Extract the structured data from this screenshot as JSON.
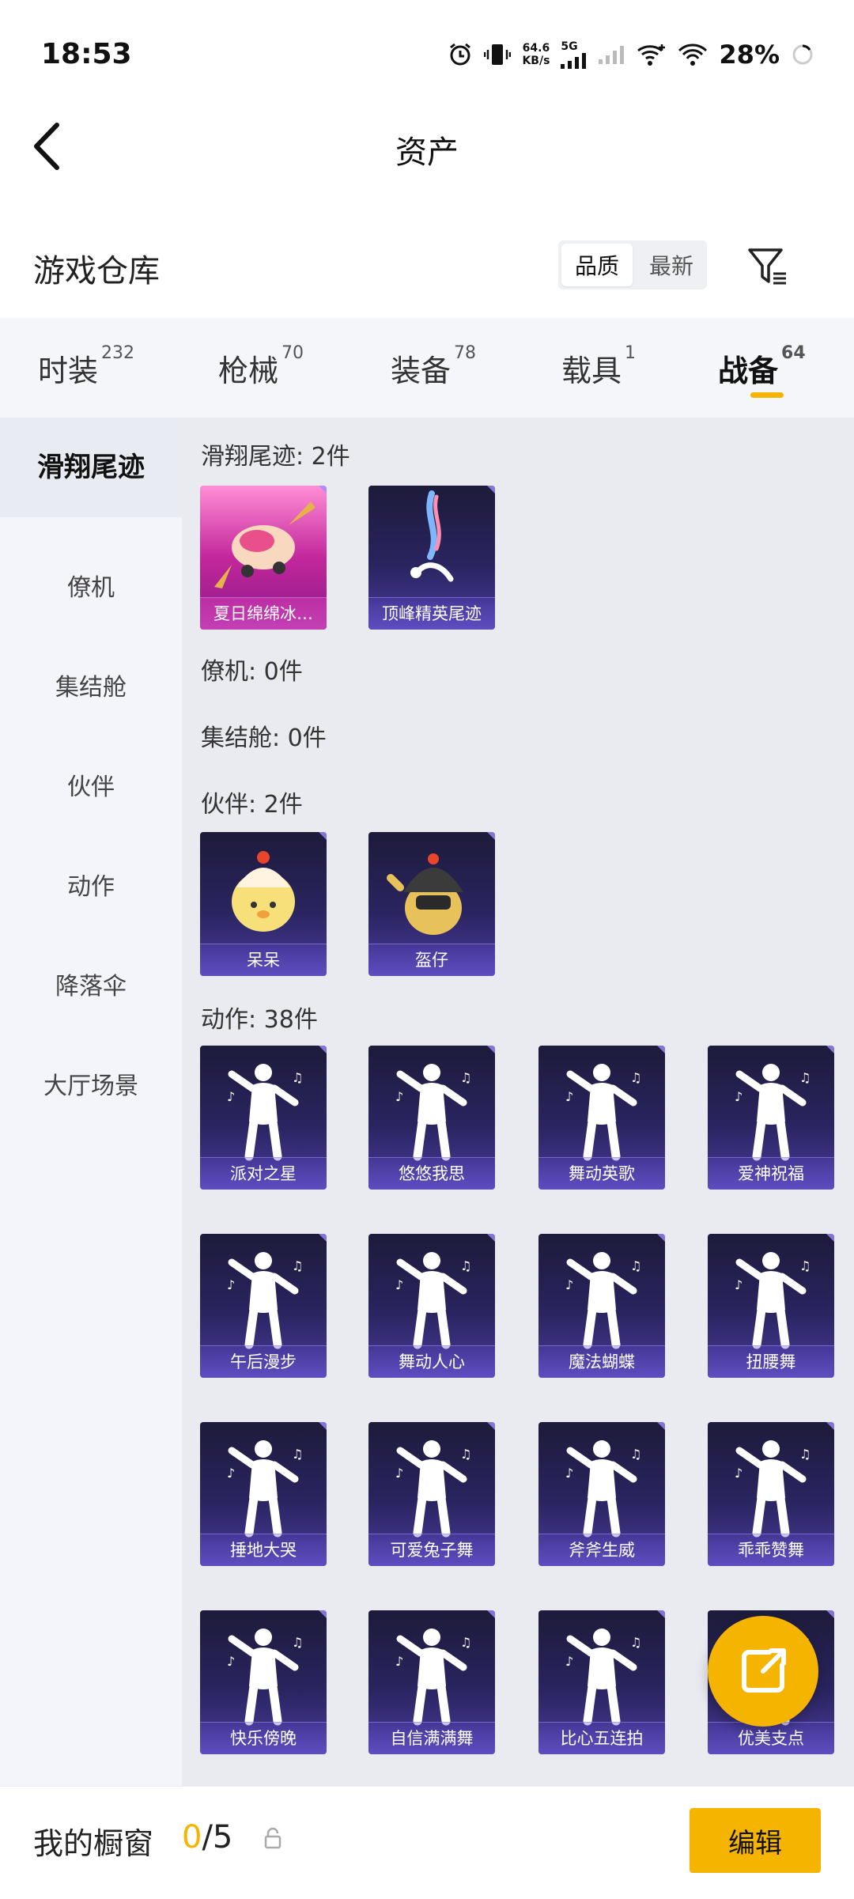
{
  "status_bar": {
    "time": "18:53",
    "net_speed_value": "64.6",
    "net_speed_unit": "KB/s",
    "network_type": "5G",
    "battery": "28%"
  },
  "header": {
    "title": "资产"
  },
  "warehouse": {
    "title": "游戏仓库",
    "sort_options": [
      "品质",
      "最新"
    ],
    "sort_selected": "品质"
  },
  "tabs": [
    {
      "label": "时装",
      "count": "232"
    },
    {
      "label": "枪械",
      "count": "70"
    },
    {
      "label": "装备",
      "count": "78"
    },
    {
      "label": "载具",
      "count": "1"
    },
    {
      "label": "战备",
      "count": "64",
      "active": true
    }
  ],
  "sidebar": {
    "items": [
      "滑翔尾迹",
      "僚机",
      "集结舱",
      "伙伴",
      "动作",
      "降落伞",
      "大厅场景"
    ],
    "active": "滑翔尾迹"
  },
  "sections": [
    {
      "title": "滑翔尾迹: 2件",
      "items": [
        "夏日绵绵冰…",
        "顶峰精英尾迹"
      ]
    },
    {
      "title": "僚机: 0件",
      "items": []
    },
    {
      "title": "集结舱: 0件",
      "items": []
    },
    {
      "title": "伙伴: 2件",
      "items": [
        "呆呆",
        "盔仔"
      ]
    },
    {
      "title": "动作: 38件",
      "items": [
        "派对之星",
        "悠悠我思",
        "舞动英歌",
        "爱神祝福",
        "午后漫步",
        "舞动人心",
        "魔法蝴蝶",
        "扭腰舞",
        "捶地大哭",
        "可爱兔子舞",
        "斧斧生威",
        "乖乖赞舞",
        "快乐傍晚",
        "自信满满舞",
        "比心五连拍",
        "优美支点"
      ]
    }
  ],
  "bottom_bar": {
    "label": "我的橱窗",
    "count_current": "0",
    "count_total": "/5",
    "edit_label": "编辑"
  },
  "colors": {
    "accent": "#f5b400",
    "card_purple": "#2a2460",
    "card_pink": "#c3279c"
  }
}
